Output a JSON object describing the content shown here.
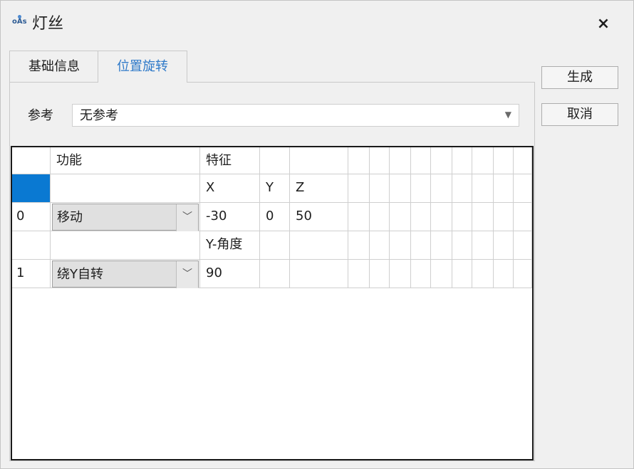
{
  "window": {
    "title": "灯丝",
    "icon": "oas-app-icon",
    "icon_text": "oÅs"
  },
  "close_label": "×",
  "tabs": [
    {
      "label": "基础信息",
      "active": false
    },
    {
      "label": "位置旋转",
      "active": true
    }
  ],
  "reference": {
    "label": "参考",
    "value": "无参考"
  },
  "buttons": {
    "generate": "生成",
    "cancel": "取消"
  },
  "grid": {
    "headers": [
      "",
      "功能",
      "特征",
      "",
      ""
    ],
    "rows": [
      {
        "index": "",
        "function": "",
        "cells": [
          "X",
          "Y",
          "Z"
        ]
      },
      {
        "index": "0",
        "function": "移动",
        "cells": [
          "-30",
          "0",
          "50"
        ]
      },
      {
        "index": "",
        "function": "",
        "cells": [
          "Y-角度",
          "",
          ""
        ]
      },
      {
        "index": "1",
        "function": "绕Y自转",
        "cells": [
          "90",
          "",
          ""
        ]
      }
    ]
  },
  "colors": {
    "accent": "#2f7ac9",
    "selection": "#0a79d2"
  }
}
